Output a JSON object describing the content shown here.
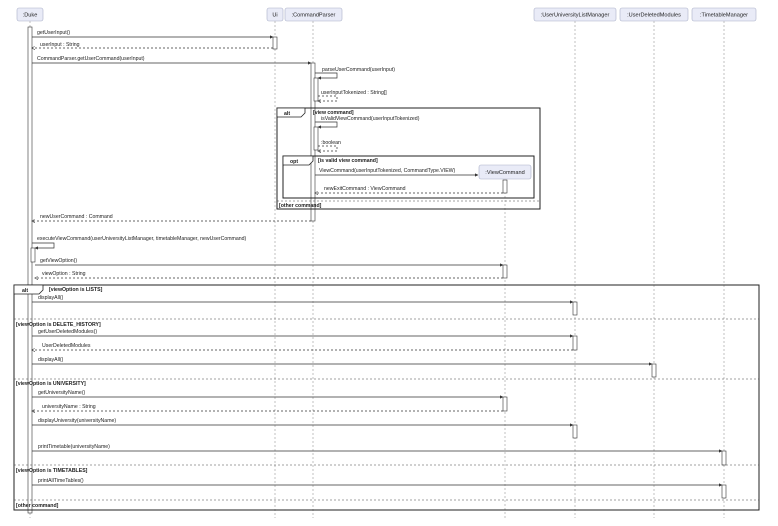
{
  "participants": [
    {
      "id": "duke",
      "label": ":Duke"
    },
    {
      "id": "ui",
      "label": "Ui"
    },
    {
      "id": "cp",
      "label": ":CommandParser"
    },
    {
      "id": "ulm",
      "label": ":UserUniversityListManager"
    },
    {
      "id": "udm",
      "label": ":UserDeletedModules"
    },
    {
      "id": "tm",
      "label": ":TimetableManager"
    },
    {
      "id": "vc",
      "label": ":ViewCommand"
    }
  ],
  "messages": [
    {
      "id": "m1",
      "text": "getUserInput()"
    },
    {
      "id": "m2",
      "text": "userInput : String"
    },
    {
      "id": "m3",
      "text": "CommandParser.getUserCommand(userInput)"
    },
    {
      "id": "m4",
      "text": "parseUserCommand(userInput)"
    },
    {
      "id": "m5",
      "text": "userInputTokenized : String[]"
    },
    {
      "id": "m6",
      "text": "isValidViewCommand(userInputTokenized)"
    },
    {
      "id": "m7",
      "text": ":boolean"
    },
    {
      "id": "m8",
      "text": "ViewCommand(userInputTokenized, CommandType.VIEW)"
    },
    {
      "id": "m9",
      "text": "newExitCommand : ViewCommand"
    },
    {
      "id": "m10",
      "text": "newUserCommand : Command"
    },
    {
      "id": "m11",
      "text": "executeViewCommand(userUniversityListManager, timetableManager, newUserCommand)"
    },
    {
      "id": "m12",
      "text": "getViewOption()"
    },
    {
      "id": "m13",
      "text": "viewOption : String"
    },
    {
      "id": "m14",
      "text": "displayAll()"
    },
    {
      "id": "m15",
      "text": "getUserDeletedModules()"
    },
    {
      "id": "m16",
      "text": "UserDeletedModules"
    },
    {
      "id": "m17",
      "text": "displayAll()"
    },
    {
      "id": "m18",
      "text": "getUniversityName()"
    },
    {
      "id": "m19",
      "text": "universityName : String"
    },
    {
      "id": "m20",
      "text": "displayUniversity(universityName)"
    },
    {
      "id": "m21",
      "text": "printTimetable(universityName)"
    },
    {
      "id": "m22",
      "text": "printAllTimeTables()"
    }
  ],
  "fragments": {
    "alt_inner": {
      "keyword": "alt",
      "guard": "[view command]",
      "else_guard": "[other command]"
    },
    "opt_inner": {
      "keyword": "opt",
      "guard": "[is valid view command]"
    },
    "alt_outer": {
      "keyword": "alt",
      "guard": "[viewOption is LISTS]",
      "else_guards": [
        "[viewOption is DELETE_HISTORY]",
        "[viewOption is UNIVERSITY]",
        "[viewOption is TIMETABLES]",
        "[other command]"
      ]
    }
  },
  "colors": {
    "participant_fill": "#e9ebf7",
    "participant_border": "#aab0c8",
    "lifeline": "#9a9a9a",
    "line": "#333333",
    "activation_fill": "#ffffff"
  }
}
